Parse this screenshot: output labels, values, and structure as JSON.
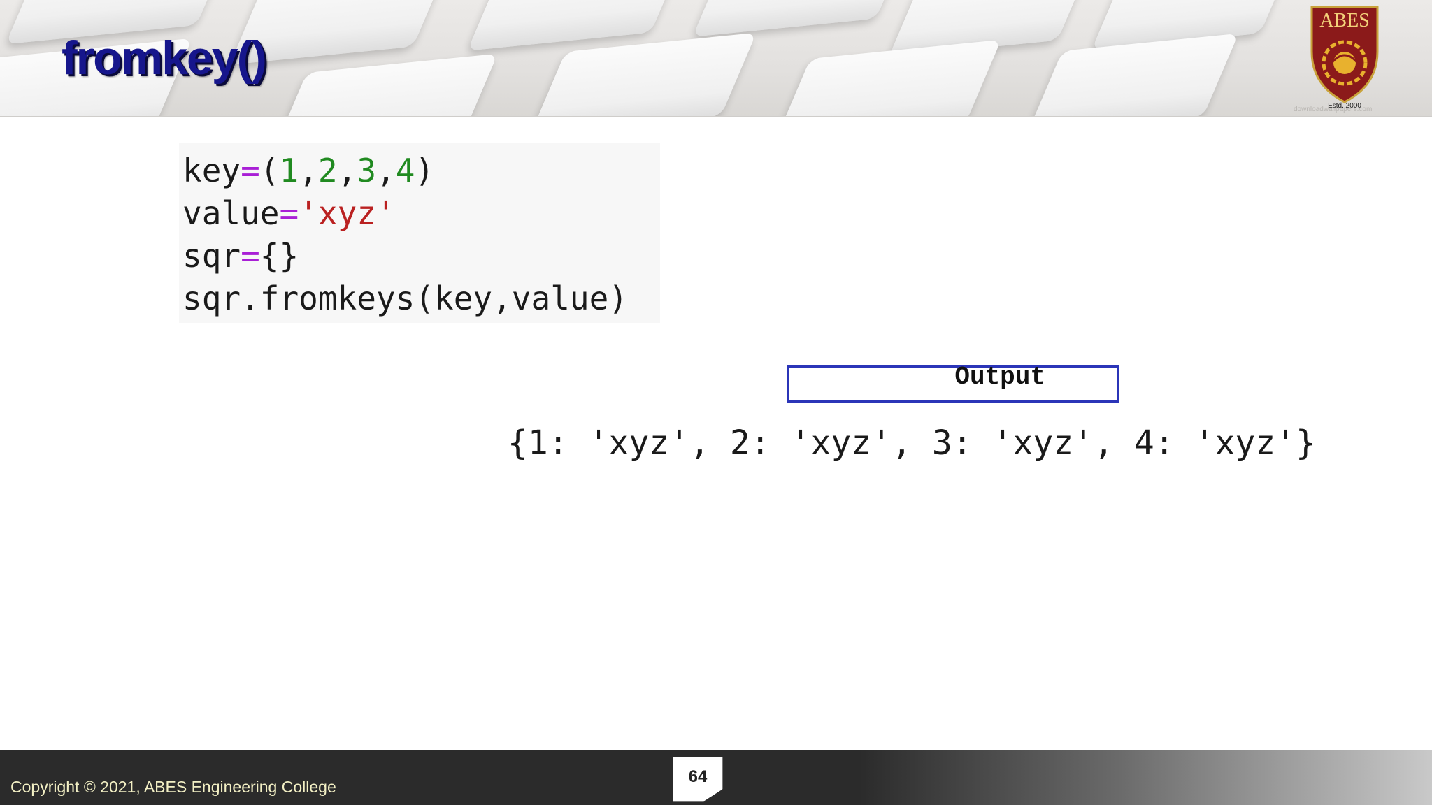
{
  "slide": {
    "title": "fromkey()",
    "logo": {
      "text": "ABES",
      "est": "Estd. 2000",
      "icon": "abes-shield-icon",
      "colors": {
        "shield": "#8b1a1a",
        "emblem": "#e8b12e"
      }
    },
    "watermark": "downloadwallpapers.com",
    "code_lines": [
      {
        "parts": [
          {
            "t": "key",
            "c": "plain"
          },
          {
            "t": "=",
            "c": "op"
          },
          {
            "t": "(",
            "c": "plain"
          },
          {
            "t": "1",
            "c": "num"
          },
          {
            "t": ",",
            "c": "plain"
          },
          {
            "t": "2",
            "c": "num"
          },
          {
            "t": ",",
            "c": "plain"
          },
          {
            "t": "3",
            "c": "num"
          },
          {
            "t": ",",
            "c": "plain"
          },
          {
            "t": "4",
            "c": "num"
          },
          {
            "t": ")",
            "c": "plain"
          }
        ]
      },
      {
        "parts": [
          {
            "t": "value",
            "c": "plain"
          },
          {
            "t": "=",
            "c": "op"
          },
          {
            "t": "'xyz'",
            "c": "str"
          }
        ]
      },
      {
        "parts": [
          {
            "t": "sqr",
            "c": "plain"
          },
          {
            "t": "=",
            "c": "op"
          },
          {
            "t": "{}",
            "c": "plain"
          }
        ]
      },
      {
        "parts": [
          {
            "t": "sqr.fromkeys(key,value)",
            "c": "plain"
          }
        ]
      }
    ],
    "output_label": "Output",
    "result": "{1: 'xyz', 2: 'xyz', 3: 'xyz', 4: 'xyz'}",
    "footer": {
      "copyright": "Copyright © 2021, ABES Engineering College",
      "page_number": "64"
    },
    "colors": {
      "title": "#16168c",
      "output_border": "#2b35b8",
      "operator": "#a91fd6",
      "number": "#208a20",
      "string": "#ba2121"
    }
  }
}
